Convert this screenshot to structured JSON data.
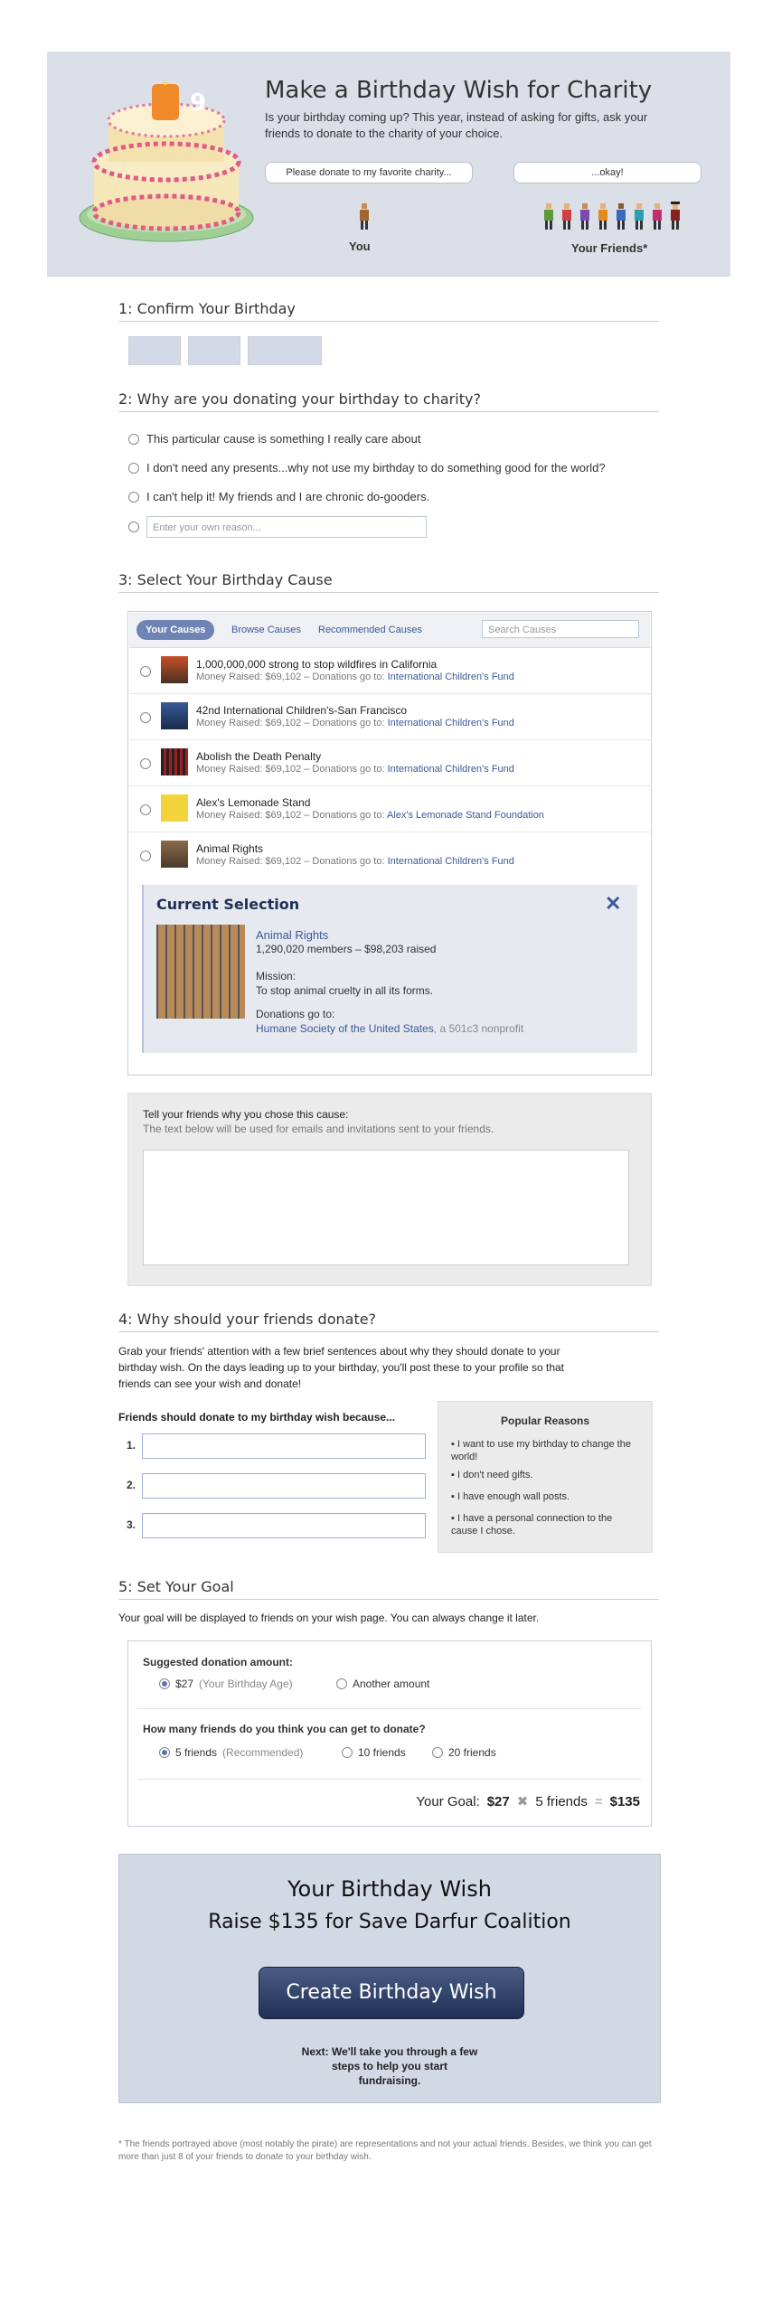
{
  "hero": {
    "cake_number": "9",
    "title": "Make a Birthday Wish for Charity",
    "subtitle": "Is your birthday coming up? This year, instead of asking for gifts, ask your friends to donate to the charity of your choice.",
    "you_bubble": "Please donate to my favorite charity...",
    "friends_bubble": "...okay!",
    "you_label": "You",
    "friends_label": "Your Friends*"
  },
  "step1": {
    "title": "1: Confirm Your Birthday"
  },
  "step2": {
    "title": "2: Why are you donating your birthday to charity?",
    "options": [
      "This particular cause is something I really care about",
      "I don't need any presents...why not use my birthday to do something good for the world?",
      "I can't help it! My friends and I are chronic do-gooders."
    ],
    "own_placeholder": "Enter your own reason..."
  },
  "step3": {
    "title": "3: Select Your Birthday Cause",
    "tabs": [
      "Your Causes",
      "Browse Causes",
      "Recommended Causes"
    ],
    "search_placeholder": "Search Causes",
    "meta_prefix": "Money Raised: $69,102 – Donations go to:",
    "causes": [
      {
        "name": "1,000,000,000 strong to stop wildfires in California",
        "beneficiary": "International Children's Fund"
      },
      {
        "name": "42nd International Children's-San Francisco",
        "beneficiary": "International Children's Fund"
      },
      {
        "name": "Abolish the Death Penalty",
        "beneficiary": "International Children's Fund"
      },
      {
        "name": "Alex's Lemonade Stand",
        "beneficiary": "Alex's Lemonade Stand Foundation"
      },
      {
        "name": "Animal Rights",
        "beneficiary": "International Children's Fund"
      }
    ],
    "current": {
      "heading": "Current Selection",
      "name": "Animal Rights",
      "stats": "1,290,020 members – $98,203 raised",
      "mission_label": "Mission:",
      "mission": "To stop animal cruelty in all its forms.",
      "donations_label": "Donations go to:",
      "org": "Humane Society of the United States",
      "org_suffix": ", a 501c3 nonprofit"
    },
    "tell_title": "Tell your friends why you chose this cause:",
    "tell_sub": "The text below will be used for emails and invitations sent to your friends."
  },
  "step4": {
    "title": "4: Why should your friends donate?",
    "intro": "Grab your friends' attention with a few brief sentences about why they should donate to your birthday wish. On the days leading up to your birthday, you'll post these to your profile so that friends can see your wish and donate!",
    "prompt": "Friends should donate to my birthday wish because...",
    "numbers": [
      "1.",
      "2.",
      "3."
    ],
    "popular_title": "Popular Reasons",
    "popular": [
      "I want to use my birthday to change the world!",
      "I don't need gifts.",
      "I have enough wall posts.",
      "I have a personal connection to the cause I chose."
    ]
  },
  "step5": {
    "title": "5: Set Your Goal",
    "intro": "Your goal will be displayed to friends on your wish page. You can always change it later.",
    "amount_label": "Suggested donation amount:",
    "amount_option": "$27",
    "amount_note": "(Your Birthday Age)",
    "amount_other": "Another amount",
    "friends_label": "How many friends do you think you can get to donate?",
    "friends_option": "5 friends",
    "friends_note": "(Recommended)",
    "friends_10": "10 friends",
    "friends_20": "20 friends",
    "goal_label": "Your Goal:",
    "goal_amount": "$27",
    "goal_times": "✖",
    "goal_friends": "5 friends",
    "goal_eq": "=",
    "goal_total": "$135"
  },
  "wish": {
    "title": "Your Birthday Wish",
    "subtitle": "Raise $135 for Save Darfur Coalition",
    "button": "Create Birthday Wish",
    "next": "Next: We'll take you through a few steps to help you start fundraising."
  },
  "footnote": "* The friends portrayed above (most notably the pirate) are representations and not your actual friends. Besides, we think you can get more than just 8 of your friends to donate to your birthday wish.",
  "colors": {
    "link": "#3b5998",
    "hero_bg": "#dbdfe8",
    "button": "#2b3a60"
  }
}
